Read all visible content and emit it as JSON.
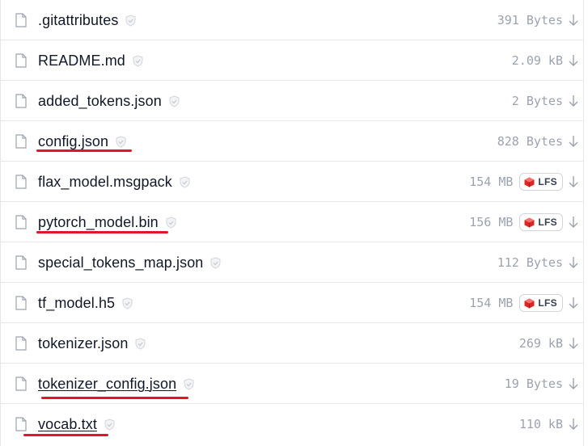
{
  "files": [
    {
      "name": ".gitattributes",
      "size": "391 Bytes",
      "lfs": false
    },
    {
      "name": "README.md",
      "size": "2.09 kB",
      "lfs": false
    },
    {
      "name": "added_tokens.json",
      "size": "2 Bytes",
      "lfs": false
    },
    {
      "name": "config.json",
      "size": "828 Bytes",
      "lfs": false
    },
    {
      "name": "flax_model.msgpack",
      "size": "154 MB",
      "lfs": true
    },
    {
      "name": "pytorch_model.bin",
      "size": "156 MB",
      "lfs": true
    },
    {
      "name": "special_tokens_map.json",
      "size": "112 Bytes",
      "lfs": false
    },
    {
      "name": "tf_model.h5",
      "size": "154 MB",
      "lfs": true
    },
    {
      "name": "tokenizer.json",
      "size": "269 kB",
      "lfs": false
    },
    {
      "name": "tokenizer_config.json",
      "size": "19 Bytes",
      "lfs": false
    },
    {
      "name": "vocab.txt",
      "size": "110 kB",
      "lfs": false
    }
  ],
  "lfs_label": "LFS",
  "colors": {
    "annotation": "#e0152a",
    "lfs_icon": "#dc2626"
  }
}
